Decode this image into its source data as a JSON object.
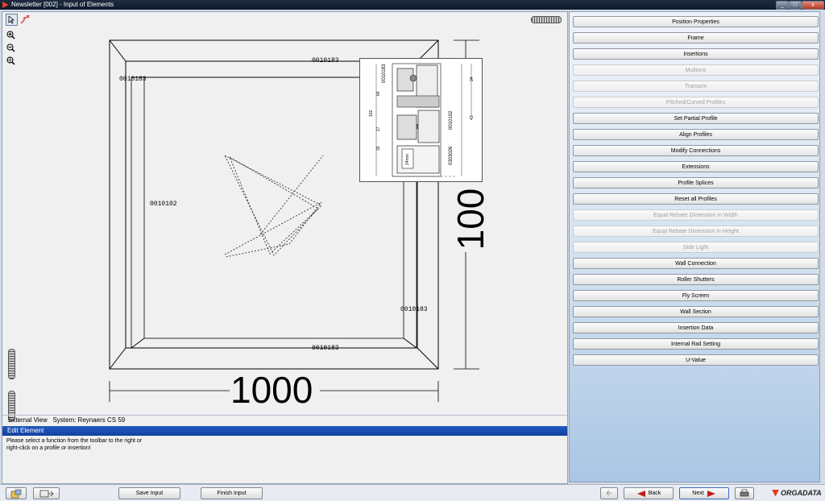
{
  "window": {
    "title": "Newsletter [002] - Input of Elements",
    "buttons": [
      "_",
      "□",
      "x"
    ]
  },
  "drawing": {
    "profile_labels": {
      "top": "0010183",
      "left_top": "0010183",
      "left": "0010102",
      "right_bottom": "0010183",
      "bottom": "0010183"
    },
    "width_dimension": "1000",
    "height_dimension": "100",
    "detail": {
      "labels": [
        "0010183",
        "0010102",
        "0303026"
      ],
      "measurements": [
        "64",
        "102",
        "17",
        "33",
        "34",
        "43",
        "24mm"
      ]
    }
  },
  "status": {
    "view": "External View",
    "system": "System: Reynaers CS 59"
  },
  "edit_element": {
    "header": "Edit Element",
    "line1": "Please select a function from the toolbar to the right or",
    "line2": "right-click on a profile or insertion!"
  },
  "functions": [
    {
      "label": "Position Properties",
      "enabled": true
    },
    {
      "label": "Frame",
      "enabled": true
    },
    {
      "label": "Insertions",
      "enabled": true
    },
    {
      "label": "Mullions",
      "enabled": false
    },
    {
      "label": "Transom",
      "enabled": false
    },
    {
      "label": "Pitched/Curved Profiles",
      "enabled": false
    },
    {
      "label": "Set Partial Profile",
      "enabled": true
    },
    {
      "label": "Align Profiles",
      "enabled": true
    },
    {
      "label": "Modify Connections",
      "enabled": true
    },
    {
      "label": "Extensions",
      "enabled": true
    },
    {
      "label": "Profile Splices",
      "enabled": true
    },
    {
      "label": "Reset all Profiles",
      "enabled": true
    },
    {
      "label": "Equal Rebate Dimension in Width",
      "enabled": false
    },
    {
      "label": "Equal Rebate Dimension in Height",
      "enabled": false
    },
    {
      "label": "Side Light",
      "enabled": false
    },
    {
      "label": "Wall Connection",
      "enabled": true
    },
    {
      "label": "Roller Shutters",
      "enabled": true
    },
    {
      "label": "Fly Screen",
      "enabled": true
    },
    {
      "label": "Wall Section",
      "enabled": true
    },
    {
      "label": "Insertion Data",
      "enabled": true
    },
    {
      "label": "Internal Rail Setting",
      "enabled": true
    },
    {
      "label": "U-Value",
      "enabled": true
    }
  ],
  "bottom": {
    "save_input": "Save Input",
    "finish_input": "Finish Input",
    "back": "Back",
    "next": "Next",
    "logo": "ORGADATA"
  }
}
